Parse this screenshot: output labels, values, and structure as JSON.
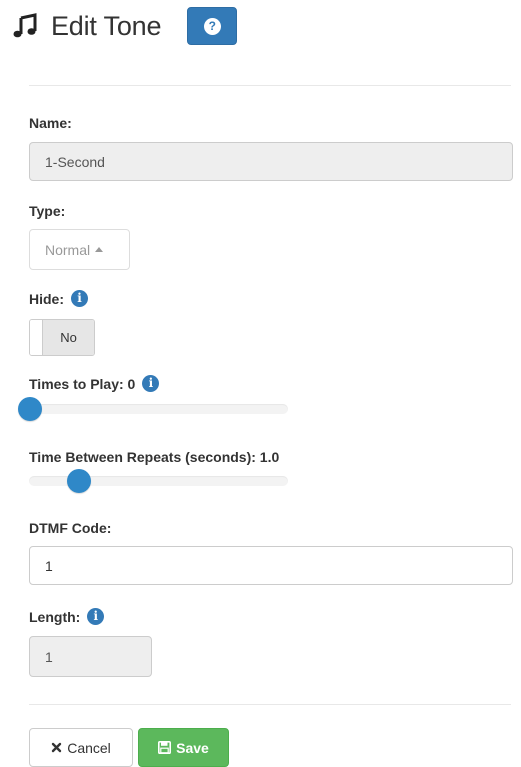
{
  "header": {
    "title": "Edit Tone",
    "help_glyph": "?",
    "title_icon": "music-note-icon",
    "help_color": "#337ab7"
  },
  "form": {
    "name": {
      "label": "Name:",
      "value": "1-Second"
    },
    "type": {
      "label": "Type:",
      "selected": "Normal"
    },
    "hide": {
      "label": "Hide:",
      "value": "No"
    },
    "times_to_play": {
      "label": "Times to Play: 0",
      "value": 0,
      "fraction": 0.0
    },
    "time_between_repeats": {
      "label": "Time Between Repeats (seconds): 1.0",
      "value": 1.0,
      "fraction": 0.19
    },
    "dtmf_code": {
      "label": "DTMF Code:",
      "value": "1"
    },
    "length": {
      "label": "Length:",
      "value": "1"
    },
    "info_glyph": "i"
  },
  "actions": {
    "cancel_label": "Cancel",
    "save_label": "Save",
    "save_color": "#5cb85c"
  }
}
